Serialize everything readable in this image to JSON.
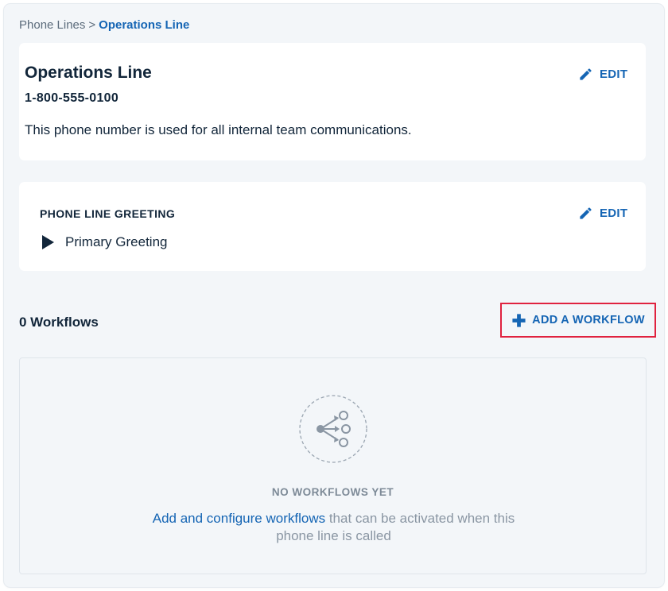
{
  "breadcrumb": {
    "parent": "Phone Lines",
    "separator": ">",
    "current": "Operations Line"
  },
  "line": {
    "name": "Operations Line",
    "number": "1-800-555-0100",
    "description": "This phone number is used for all internal team communications.",
    "edit_label": "EDIT"
  },
  "greeting": {
    "heading": "PHONE LINE GREETING",
    "name": "Primary Greeting",
    "edit_label": "EDIT"
  },
  "workflows": {
    "count_label": "0 Workflows",
    "add_label": "ADD A WORKFLOW",
    "empty_title": "NO WORKFLOWS YET",
    "empty_link": "Add and configure workflows",
    "empty_rest": " that can be activated when this phone line is called"
  },
  "icons": {
    "edit": "pencil-icon",
    "play": "play-icon",
    "add": "plus-icon",
    "empty": "workflow-branch-icon"
  },
  "colors": {
    "accent": "#1565b4",
    "text": "#12263a",
    "muted": "#8a96a3",
    "panel_bg": "#f3f6f9",
    "highlight_border": "#e0223f"
  }
}
